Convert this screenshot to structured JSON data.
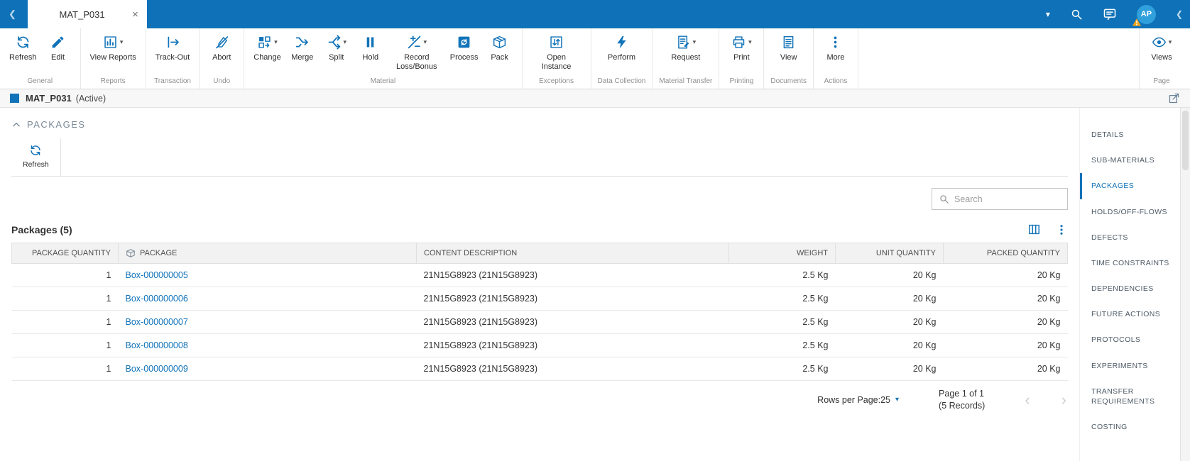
{
  "icons": {
    "close": "×",
    "chevron_down": "▾",
    "caret": "▾",
    "chevron_left": "❮",
    "prev": "‹",
    "next": "›"
  },
  "colors": {
    "accent": "#1173B9",
    "titlebar": "#0F72B8",
    "link": "#1173B9",
    "warning": "#F2A51A",
    "table_header_bg": "#F2F2F2"
  },
  "titlebar": {
    "tab_label": "MAT_P031",
    "avatar_initials": "AP"
  },
  "toolbar": {
    "groups": [
      {
        "label": "General",
        "buttons": [
          {
            "label": "Refresh"
          },
          {
            "label": "Edit"
          }
        ]
      },
      {
        "label": "Reports",
        "buttons": [
          {
            "label": "View Reports",
            "dropdown": true
          }
        ]
      },
      {
        "label": "Transaction",
        "buttons": [
          {
            "label": "Track-Out"
          }
        ]
      },
      {
        "label": "Undo",
        "buttons": [
          {
            "label": "Abort"
          }
        ]
      },
      {
        "label": "Material",
        "buttons": [
          {
            "label": "Change",
            "dropdown": true
          },
          {
            "label": "Merge"
          },
          {
            "label": "Split",
            "dropdown": true
          },
          {
            "label": "Hold"
          },
          {
            "label": "Record Loss/Bonus",
            "dropdown": true
          },
          {
            "label": "Process"
          },
          {
            "label": "Pack"
          }
        ]
      },
      {
        "label": "Exceptions",
        "buttons": [
          {
            "label": "Open Instance"
          }
        ]
      },
      {
        "label": "Data Collection",
        "buttons": [
          {
            "label": "Perform"
          }
        ]
      },
      {
        "label": "Material Transfer",
        "buttons": [
          {
            "label": "Request",
            "dropdown": true
          }
        ]
      },
      {
        "label": "Printing",
        "buttons": [
          {
            "label": "Print",
            "dropdown": true
          }
        ]
      },
      {
        "label": "Documents",
        "buttons": [
          {
            "label": "View"
          }
        ]
      },
      {
        "label": "Actions",
        "buttons": [
          {
            "label": "More"
          }
        ]
      },
      {
        "label": "Page",
        "buttons": [
          {
            "label": "Views",
            "dropdown": true
          }
        ]
      }
    ]
  },
  "context_bar": {
    "title": "MAT_P031",
    "status": "(Active)"
  },
  "packages_section": {
    "title": "PACKAGES",
    "refresh_label": "Refresh"
  },
  "search": {
    "placeholder": "Search"
  },
  "packages_table": {
    "title": "Packages (5)",
    "columns": [
      "PACKAGE QUANTITY",
      "PACKAGE",
      "CONTENT DESCRIPTION",
      "WEIGHT",
      "UNIT QUANTITY",
      "PACKED QUANTITY"
    ],
    "rows": [
      {
        "package_quantity": "1",
        "package": "Box-000000005",
        "content_description": "21N15G8923 (21N15G8923)",
        "weight": "2.5 Kg",
        "unit_quantity": "20 Kg",
        "packed_quantity": "20 Kg"
      },
      {
        "package_quantity": "1",
        "package": "Box-000000006",
        "content_description": "21N15G8923 (21N15G8923)",
        "weight": "2.5 Kg",
        "unit_quantity": "20 Kg",
        "packed_quantity": "20 Kg"
      },
      {
        "package_quantity": "1",
        "package": "Box-000000007",
        "content_description": "21N15G8923 (21N15G8923)",
        "weight": "2.5 Kg",
        "unit_quantity": "20 Kg",
        "packed_quantity": "20 Kg"
      },
      {
        "package_quantity": "1",
        "package": "Box-000000008",
        "content_description": "21N15G8923 (21N15G8923)",
        "weight": "2.5 Kg",
        "unit_quantity": "20 Kg",
        "packed_quantity": "20 Kg"
      },
      {
        "package_quantity": "1",
        "package": "Box-000000009",
        "content_description": "21N15G8923 (21N15G8923)",
        "weight": "2.5 Kg",
        "unit_quantity": "20 Kg",
        "packed_quantity": "20 Kg"
      }
    ]
  },
  "pagination": {
    "rows_per_page": "Rows per Page:25",
    "page_line": "Page 1 of 1",
    "records_line": "(5 Records)"
  },
  "right_nav": {
    "items": [
      "DETAILS",
      "SUB-MATERIALS",
      "PACKAGES",
      "HOLDS/OFF-FLOWS",
      "DEFECTS",
      "TIME CONSTRAINTS",
      "DEPENDENCIES",
      "FUTURE ACTIONS",
      "PROTOCOLS",
      "EXPERIMENTS",
      "TRANSFER REQUIREMENTS",
      "COSTING"
    ]
  }
}
